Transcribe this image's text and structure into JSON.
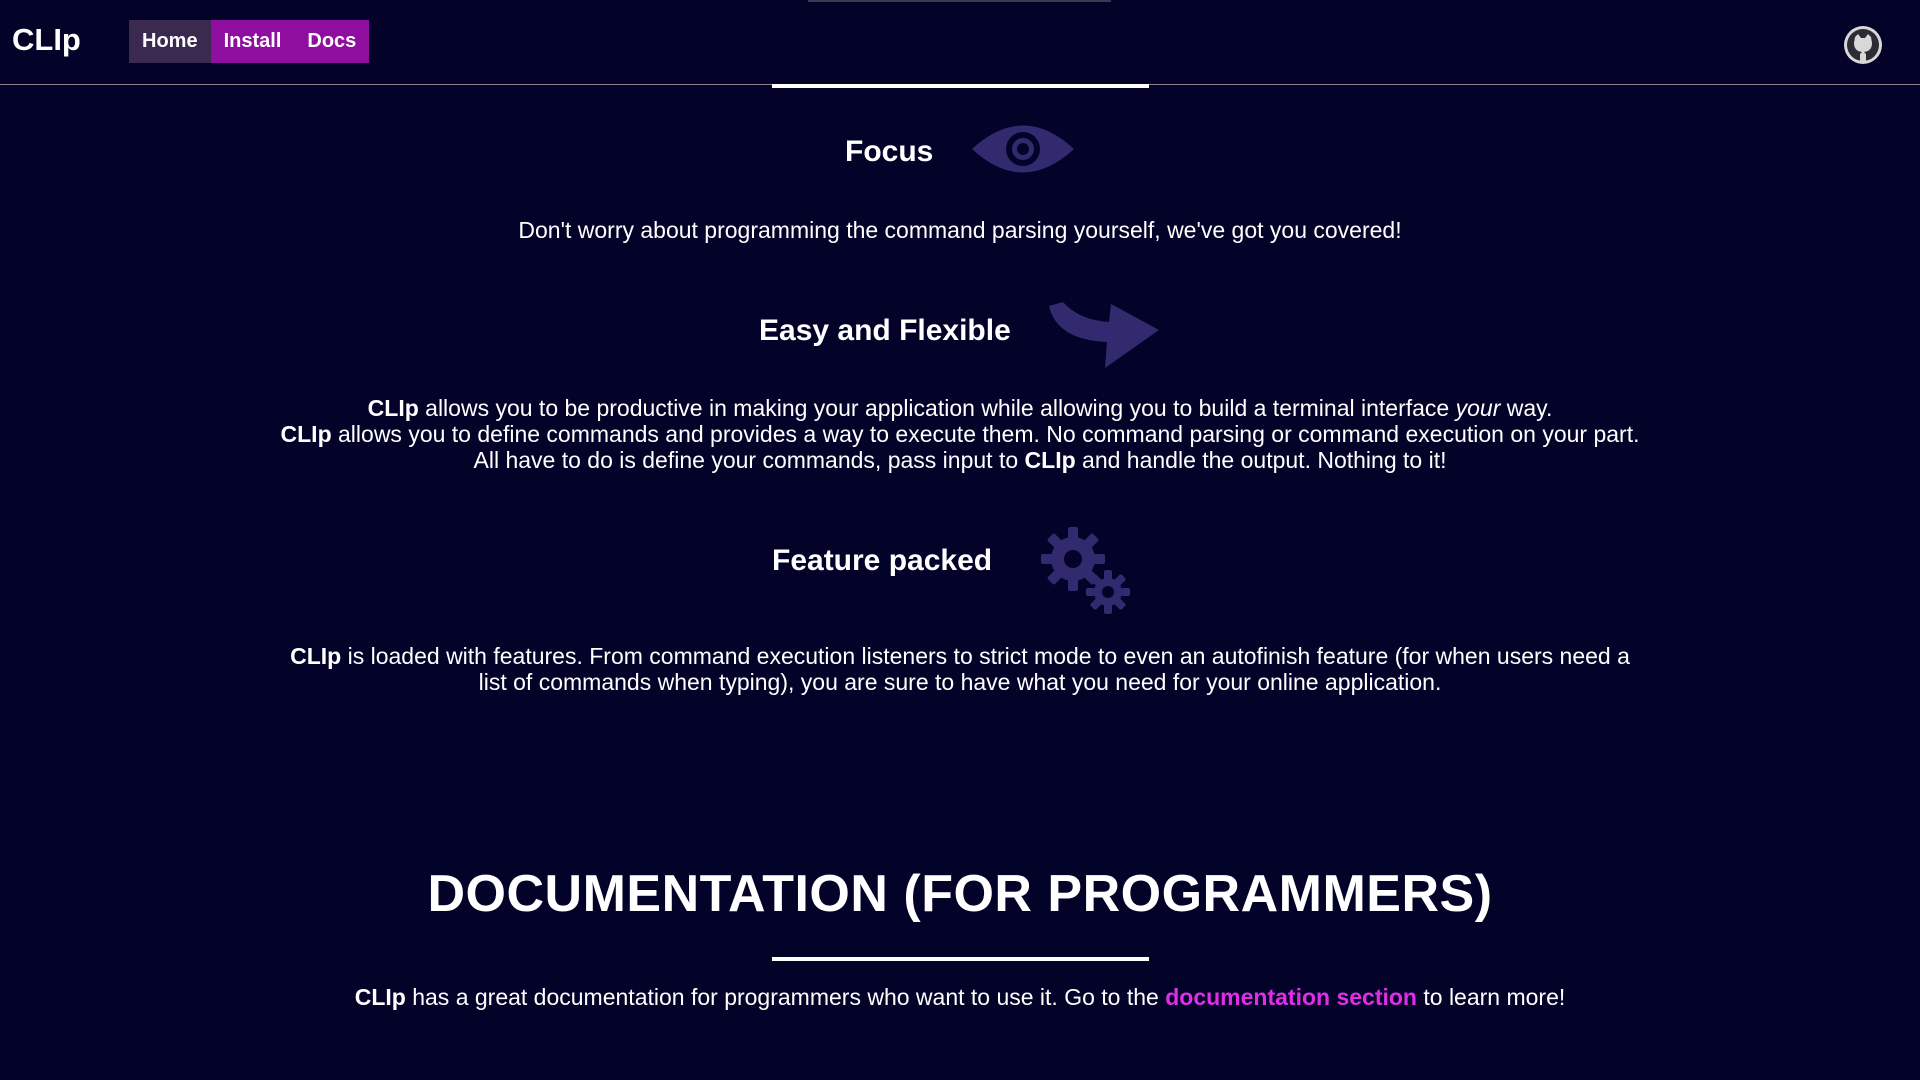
{
  "nav": {
    "brand": "CLIp",
    "items": [
      {
        "label": "Home",
        "active": true
      },
      {
        "label": "Install",
        "active": false
      },
      {
        "label": "Docs",
        "active": false
      }
    ],
    "github_icon": "github-icon"
  },
  "features": [
    {
      "title": "Focus",
      "icon": "eye-icon",
      "lines": [
        [
          {
            "t": "Don't worry about programming the command parsing yourself, we've got you covered!"
          }
        ]
      ]
    },
    {
      "title": "Easy and Flexible",
      "icon": "arrow-icon",
      "lines": [
        [
          {
            "t": "CLIp",
            "b": true
          },
          {
            "t": " allows you to be productive in making your application while allowing you to build a terminal interface "
          },
          {
            "t": "your",
            "i": true
          },
          {
            "t": " way."
          }
        ],
        [
          {
            "t": "CLIp",
            "b": true
          },
          {
            "t": " allows you to define commands and provides a way to execute them. No command parsing or command execution on your part."
          }
        ],
        [
          {
            "t": "All have to do is define your commands, pass input to "
          },
          {
            "t": "CLIp",
            "b": true
          },
          {
            "t": " and handle the output. Nothing to it!"
          }
        ]
      ]
    },
    {
      "title": "Feature packed",
      "icon": "gears-icon",
      "lines": [
        [
          {
            "t": "CLIp",
            "b": true
          },
          {
            "t": " is loaded with features. From command execution listeners to strict mode to even an autofinish feature (for when users need a"
          }
        ],
        [
          {
            "t": "list of commands when typing), you are sure to have what you need for your online application."
          }
        ]
      ]
    }
  ],
  "documentation": {
    "title": "DOCUMENTATION (FOR PROGRAMMERS)",
    "text_brand": "CLIp",
    "text_before": " has a great documentation for programmers who want to use it. Go to the ",
    "link_label": "documentation section",
    "text_after": " to learn more!"
  },
  "colors": {
    "background": "#03032a",
    "accent": "#8f0e9f",
    "active_nav": "#3b2a50",
    "icon": "#312a6e",
    "link": "#e02ee8"
  }
}
